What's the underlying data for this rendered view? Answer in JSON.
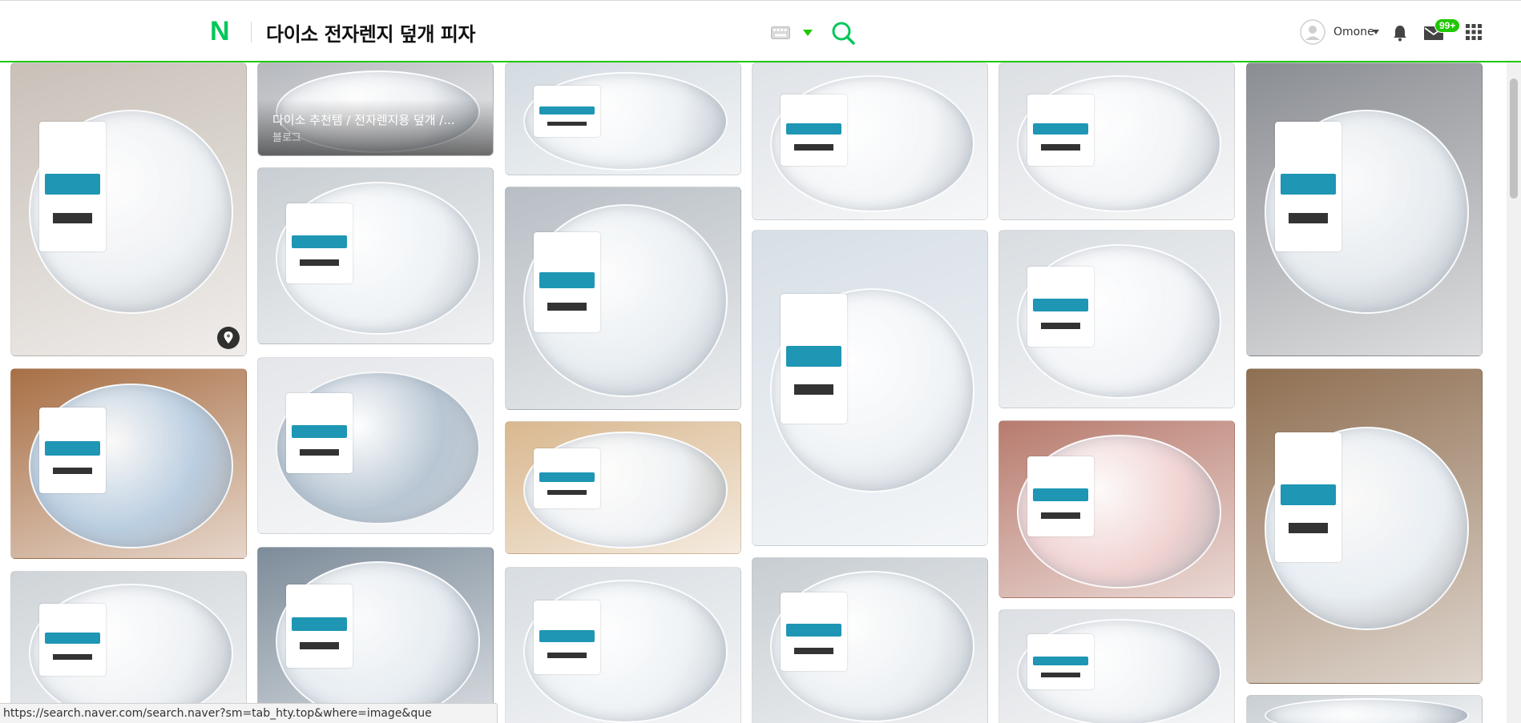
{
  "header": {
    "logo": "N",
    "query": "다이소 전자렌지 덮개 피자",
    "keyboard_icon": "keyboard-icon",
    "search_icon": "search-icon",
    "username": "Omone",
    "mail_badge": "99+",
    "colors": {
      "brand": "#03c75a",
      "accent": "#1ec800"
    }
  },
  "grid": {
    "blog_card": {
      "title": "다이소 추천템 / 전자렌지용 덮개 /...",
      "source": "블로그"
    },
    "tiles": [
      {
        "name": "image-tile-1",
        "bg": "#c9c0b8",
        "lid": "#eef1f4",
        "pin": true
      },
      {
        "name": "image-tile-2",
        "bg": "#b5b8bd",
        "lid": "#eef0f3",
        "blog": true
      },
      {
        "name": "image-tile-3",
        "bg": "#d3dbe1",
        "lid": "#eef2f5"
      },
      {
        "name": "image-tile-4",
        "bg": "#dfe3e7",
        "lid": "#f3f5f7"
      },
      {
        "name": "image-tile-5",
        "bg": "#dcdfe3",
        "lid": "#f2f4f6"
      },
      {
        "name": "image-tile-6",
        "bg": "#8a8d92",
        "lid": "#e6ebef"
      },
      {
        "name": "image-tile-7",
        "bg": "#c8ced3",
        "lid": "#eef2f5"
      },
      {
        "name": "image-tile-8",
        "bg": "#b7bec4",
        "lid": "#e9eef2"
      },
      {
        "name": "image-tile-9",
        "bg": "#d7dfe6",
        "lid": "#f0f3f6"
      },
      {
        "name": "image-tile-10",
        "bg": "#d9dde1",
        "lid": "#f2f4f7"
      },
      {
        "name": "image-tile-11",
        "bg": "#a86f45",
        "lid": "#b9cde0"
      },
      {
        "name": "image-tile-12",
        "bg": "#e4e6ea",
        "lid": "#b8c6d3"
      },
      {
        "name": "image-tile-13",
        "bg": "#d9b88f",
        "lid": "#eef1f4"
      },
      {
        "name": "image-tile-14",
        "bg": "#b87b6e",
        "lid": "#f0d3d2"
      },
      {
        "name": "image-tile-15",
        "bg": "#8f6f52",
        "lid": "#e8eef3"
      },
      {
        "name": "image-tile-16",
        "bg": "#cfd4d8",
        "lid": "#eef1f4"
      },
      {
        "name": "image-tile-17",
        "bg": "#7d8c9a",
        "lid": "#e6ecf1"
      },
      {
        "name": "image-tile-18",
        "bg": "#d8dde2",
        "lid": "#eef2f5"
      },
      {
        "name": "image-tile-19",
        "bg": "#c7cdd2",
        "lid": "#ecf0f3"
      },
      {
        "name": "image-tile-20",
        "bg": "#dcdfe3",
        "lid": "#eef1f4"
      },
      {
        "name": "image-tile-21",
        "bg": "#c8ced3",
        "lid": "#eef2f5"
      },
      {
        "name": "image-tile-22",
        "bg": "#d8dde2",
        "lid": "#eef2f5"
      }
    ]
  },
  "statusbar": {
    "url": "https://search.naver.com/search.naver?sm=tab_hty.top&where=image&que"
  }
}
